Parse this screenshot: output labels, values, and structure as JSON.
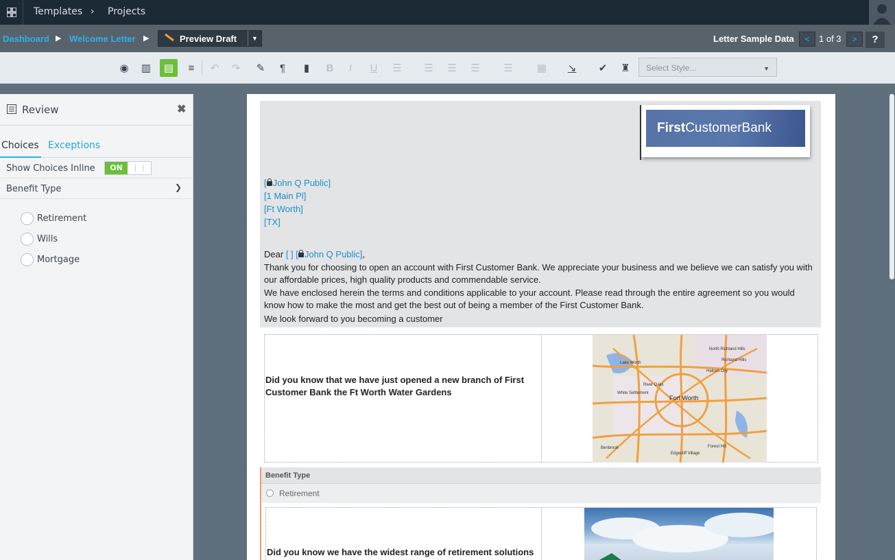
{
  "topnav": {
    "crumbs": [
      "Templates",
      "Projects"
    ]
  },
  "secondary": {
    "breadcrumbs": [
      "Dashboard",
      "Welcome Letter"
    ],
    "draft_label": "Preview Draft",
    "sample_label": "Letter Sample Data",
    "page_indicator": "1 of 3",
    "help_label": "?"
  },
  "toolbar": {
    "style_placeholder": "Select Style...",
    "active_tool": "review-icon"
  },
  "review": {
    "title": "Review",
    "tabs": [
      "Choices",
      "Exceptions"
    ],
    "show_inline_label": "Show Choices Inline",
    "toggle_state": "ON",
    "section_label": "Benefit Type",
    "options": [
      "Retirement",
      "Wills",
      "Mortgage"
    ]
  },
  "document": {
    "logo_bold": "First",
    "logo_rest": "CustomerBank",
    "address": [
      "John Q Public]",
      "[1 Main Pl]",
      "[Ft Worth]",
      "[TX]"
    ],
    "dear_prefix": "Dear",
    "dear_fields": "[ ] [",
    "dear_name": "John Q Public]",
    "body": "Thank you for choosing to open an account with First Customer Bank. We appreciate your business and we believe we can satisfy you with our affordable prices, high quality products and commendable service.",
    "body2": "We have enclosed herein the terms and conditions applicable to your account. Please read through the entire agreement so you would know how to make the most and get the best out of being a member of the First Customer Bank.",
    "body3": "We look forward to you becoming a customer",
    "branch_text": "Did you know that we have just opened a new branch of First Customer Bank the Ft Worth Water Gardens",
    "benefit_header": "Benefit Type",
    "benefit_option": "Retirement",
    "retire_text": "Did you know we have the widest range of retirement solutions",
    "map_labels": [
      "Fort Worth",
      "North Richland Hills",
      "Richland Hills",
      "Haltom City",
      "Lake Worth",
      "River Oaks",
      "White Settlement",
      "Benbrook",
      "Edgecliff Village",
      "Forest Hill"
    ]
  }
}
